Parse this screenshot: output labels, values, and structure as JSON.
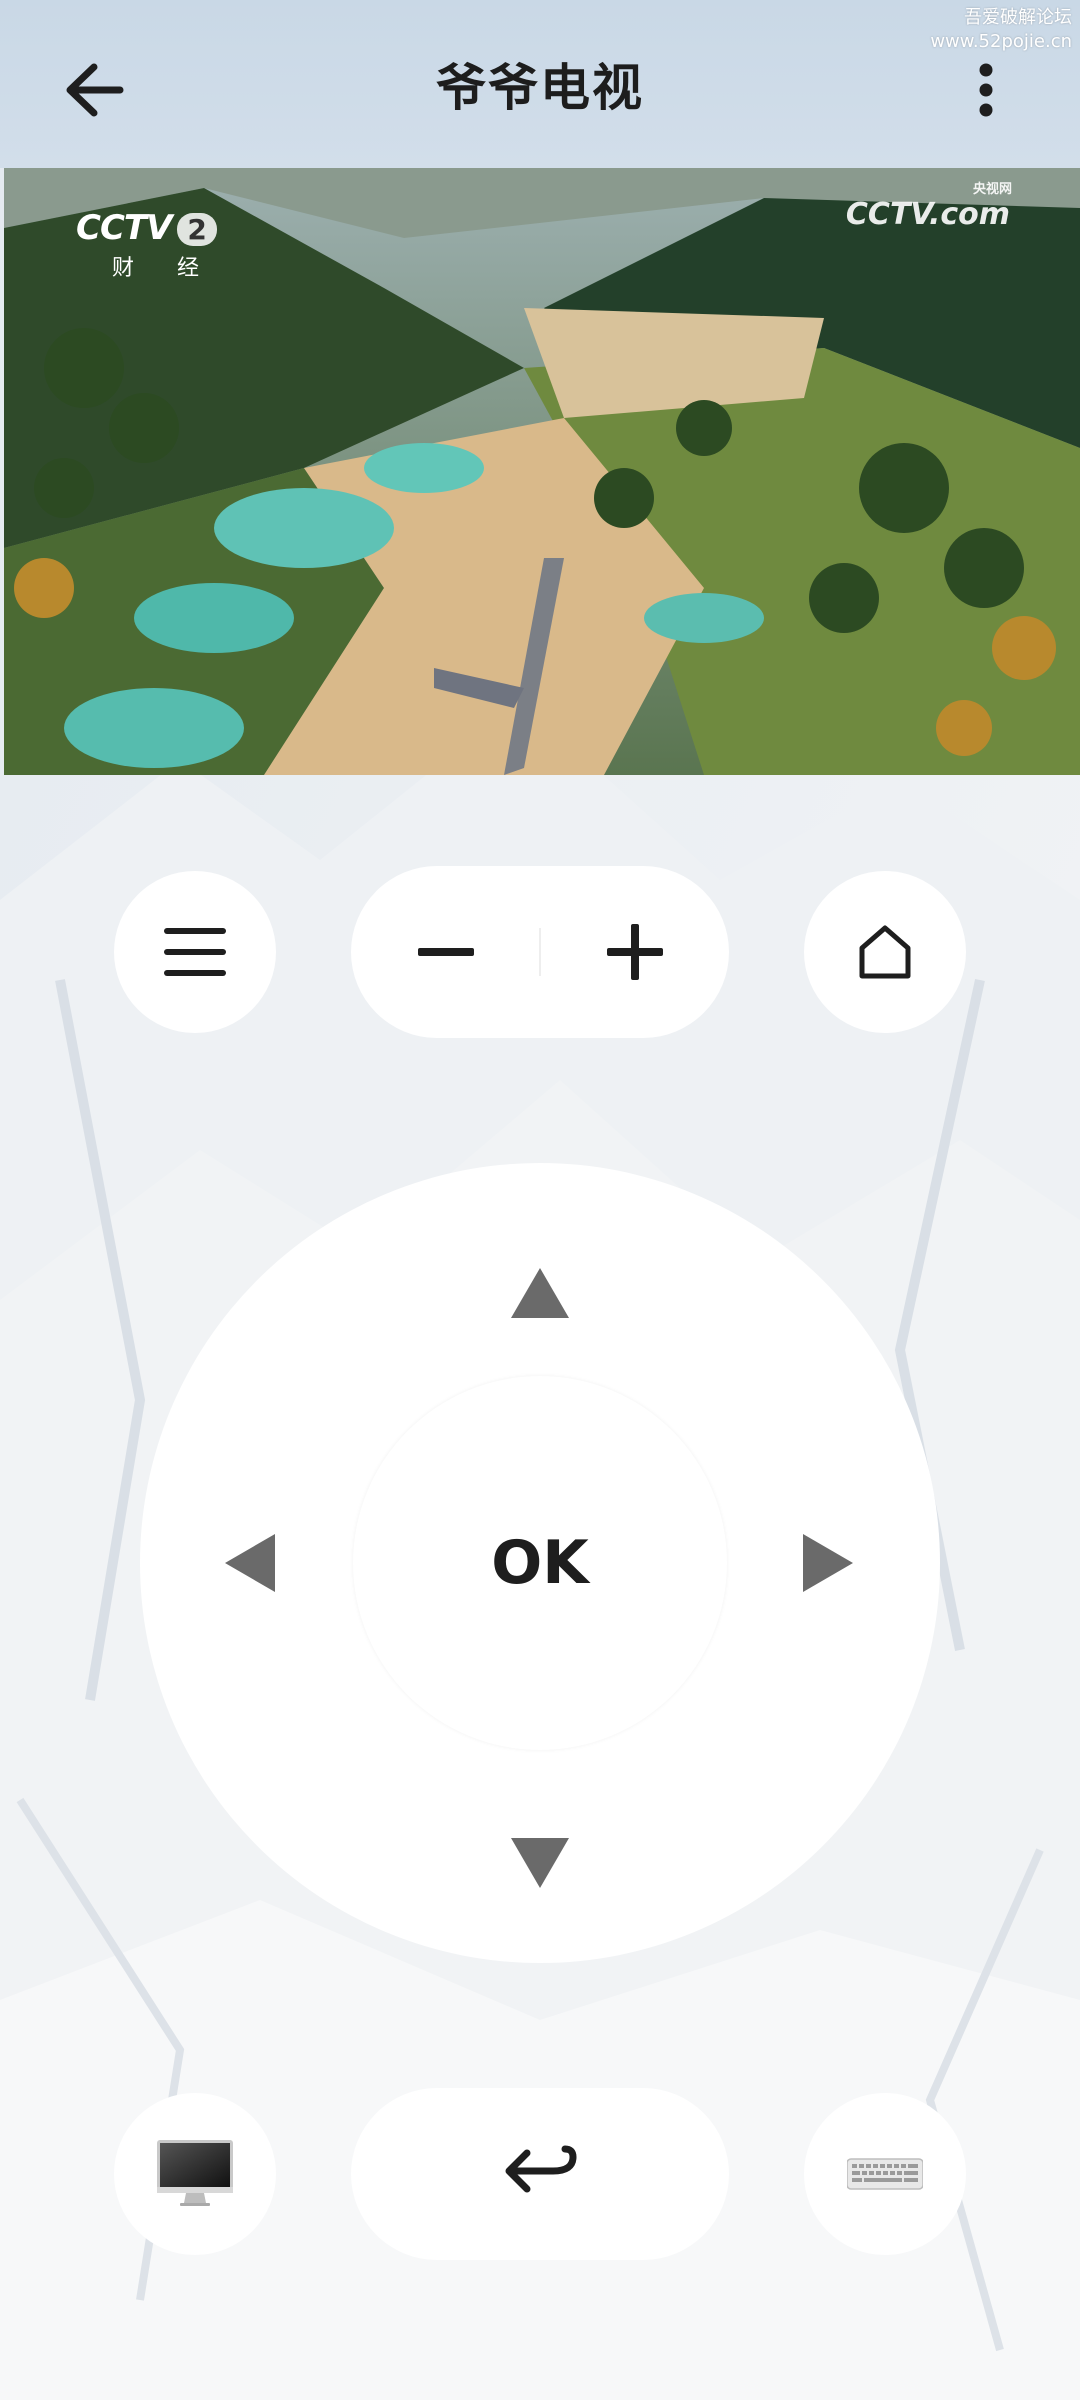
{
  "header": {
    "title": "爷爷电视",
    "back_icon": "arrow-left-icon",
    "more_icon": "more-vertical-icon"
  },
  "watermark": {
    "line1": "吾爱破解论坛",
    "line2": "www.52pojie.cn"
  },
  "video": {
    "channel_logo": "CCTV",
    "channel_number": "2",
    "channel_name": "财 经",
    "site_logo": "CCTV.com",
    "site_logo_small": "央视网"
  },
  "controls": {
    "menu_icon": "hamburger-menu-icon",
    "volume_down_icon": "minus-icon",
    "volume_up_icon": "plus-icon",
    "home_icon": "home-icon",
    "up_icon": "triangle-up-icon",
    "left_icon": "triangle-left-icon",
    "right_icon": "triangle-right-icon",
    "down_icon": "triangle-down-icon",
    "ok_label": "OK",
    "monitor_icon": "monitor-icon",
    "return_icon": "return-arrow-icon",
    "keyboard_icon": "keyboard-icon"
  },
  "colors": {
    "header_bg": "#cdd9e6",
    "button_bg": "#ffffff",
    "arrow_color": "#6a6a6a",
    "icon_color": "#1e1e1e"
  }
}
